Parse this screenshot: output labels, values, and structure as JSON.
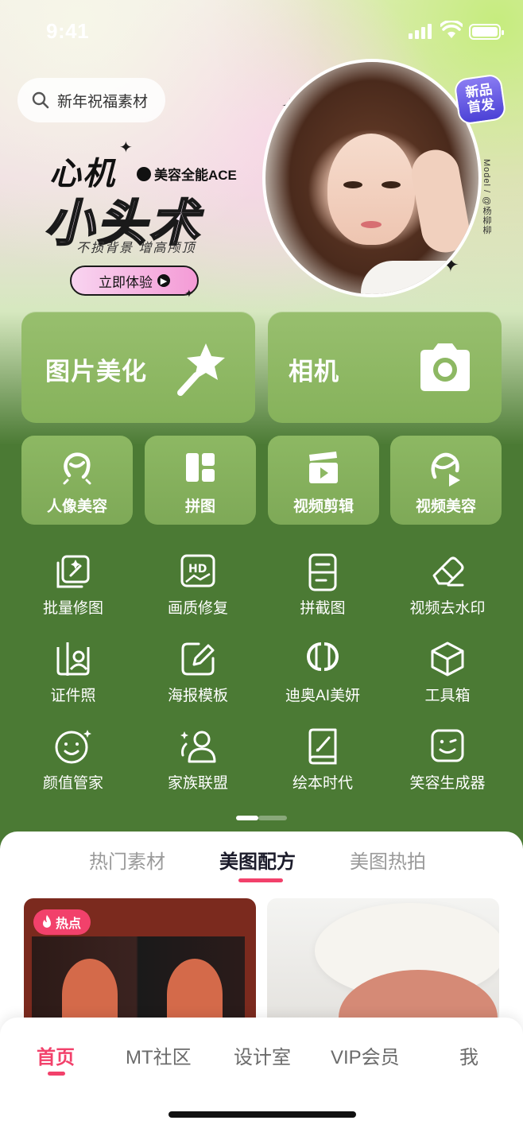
{
  "status_bar": {
    "time": "9:41"
  },
  "search": {
    "placeholder_text": "新年祝福素材"
  },
  "banner": {
    "title_top": "心机",
    "brand": "美容全能ACE",
    "title_main": "小头术",
    "subtitle": "不损背景 增高颅顶",
    "cta": "立即体验",
    "badge": "新品\n首发",
    "model_credit": "Model / @杨柳柳"
  },
  "big_cards": [
    {
      "label": "图片美化",
      "icon": "magic-wand-icon"
    },
    {
      "label": "相机",
      "icon": "camera-icon"
    }
  ],
  "mid_cards": [
    {
      "label": "人像美容",
      "icon": "portrait-icon"
    },
    {
      "label": "拼图",
      "icon": "collage-icon"
    },
    {
      "label": "视频剪辑",
      "icon": "clapperboard-icon"
    },
    {
      "label": "视频美容",
      "icon": "video-portrait-icon"
    }
  ],
  "tools": [
    {
      "label": "批量修图",
      "icon": "batch-edit-icon"
    },
    {
      "label": "画质修复",
      "icon": "hd-icon"
    },
    {
      "label": "拼截图",
      "icon": "screenshot-stitch-icon"
    },
    {
      "label": "视频去水印",
      "icon": "eraser-icon"
    },
    {
      "label": "证件照",
      "icon": "id-photo-icon"
    },
    {
      "label": "海报模板",
      "icon": "poster-edit-icon"
    },
    {
      "label": "迪奥AI美妍",
      "icon": "dior-icon"
    },
    {
      "label": "工具箱",
      "icon": "toolbox-icon"
    },
    {
      "label": "颜值管家",
      "icon": "smile-face-icon"
    },
    {
      "label": "家族联盟",
      "icon": "family-icon"
    },
    {
      "label": "绘本时代",
      "icon": "picture-book-icon"
    },
    {
      "label": "笑容生成器",
      "icon": "wink-face-icon"
    }
  ],
  "feed_tabs": [
    {
      "label": "热门素材",
      "active": false
    },
    {
      "label": "美图配方",
      "active": true
    },
    {
      "label": "美图热拍",
      "active": false
    }
  ],
  "feed": {
    "hot_badge": "热点"
  },
  "bottom_nav": [
    {
      "label": "首页",
      "active": true
    },
    {
      "label": "MT社区",
      "active": false
    },
    {
      "label": "设计室",
      "active": false
    },
    {
      "label": "VIP会员",
      "active": false
    },
    {
      "label": "我",
      "active": false
    }
  ],
  "colors": {
    "accent": "#f2416b",
    "green_bg": "#4b7a34",
    "card_green": "#8db863"
  }
}
